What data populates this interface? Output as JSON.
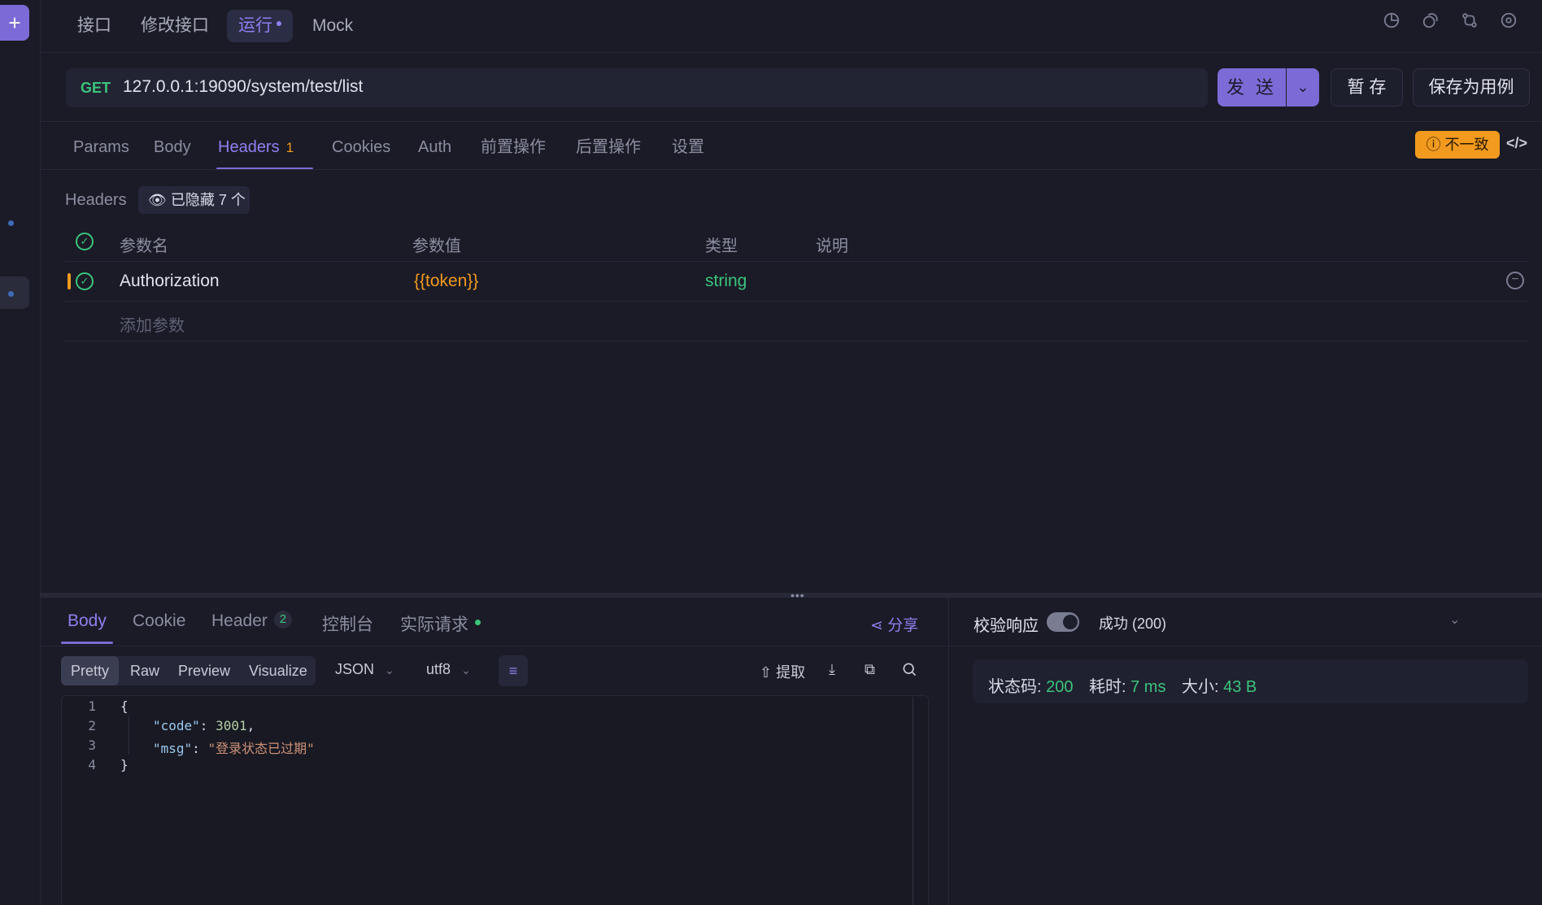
{
  "rail": {
    "add_label": "+"
  },
  "top_tabs": [
    {
      "label": "接口"
    },
    {
      "label": "修改接口"
    },
    {
      "label": "运行"
    },
    {
      "label": "Mock"
    }
  ],
  "top_icons": [
    "pie-chart-icon",
    "copy-shapes-icon",
    "git-compare-icon",
    "settings-icon"
  ],
  "request": {
    "method": "GET",
    "url": "127.0.0.1:19090/system/test/list",
    "send_label": "发 送",
    "save_draft_label": "暂 存",
    "save_case_label": "保存为用例",
    "mismatch_label": "不一致"
  },
  "request_tabs": [
    {
      "label": "Params"
    },
    {
      "label": "Body"
    },
    {
      "label": "Headers",
      "badge": "1"
    },
    {
      "label": "Cookies"
    },
    {
      "label": "Auth"
    },
    {
      "label": "前置操作"
    },
    {
      "label": "后置操作"
    },
    {
      "label": "设置"
    }
  ],
  "headers": {
    "section_label": "Headers",
    "hidden_label": "已隐藏 7 个",
    "columns": [
      "参数名",
      "参数值",
      "类型",
      "说明"
    ],
    "rows": [
      {
        "name": "Authorization",
        "value": "{{token}}",
        "type": "string",
        "desc": ""
      }
    ],
    "add_placeholder": "添加参数"
  },
  "response": {
    "tabs": [
      {
        "label": "Body"
      },
      {
        "label": "Cookie"
      },
      {
        "label": "Header",
        "badge": "2"
      },
      {
        "label": "控制台"
      },
      {
        "label": "实际请求"
      }
    ],
    "share_label": "分享",
    "formats": [
      "Pretty",
      "Raw",
      "Preview",
      "Visualize"
    ],
    "lang": "JSON",
    "encoding": "utf8",
    "extract_label": "提取",
    "code_lines": [
      "{",
      "\"code\": 3001,",
      "\"msg\": \"登录状态已过期\"",
      "}"
    ],
    "code_key_code": "\"code\"",
    "code_val_code": "3001",
    "code_key_msg": "\"msg\"",
    "code_val_msg": "\"登录状态已过期\"",
    "line_numbers": [
      "1",
      "2",
      "3",
      "4"
    ]
  },
  "validation": {
    "label": "校验响应",
    "result": "成功 (200)",
    "status_label": "状态码:",
    "status_value": "200",
    "time_label": "耗时:",
    "time_value": "7 ms",
    "size_label": "大小:",
    "size_value": "43 B"
  },
  "colors": {
    "accent": "#7c6bd6",
    "success": "#3cc47c",
    "warning": "#f29a1d",
    "background": "#1a1b26"
  }
}
